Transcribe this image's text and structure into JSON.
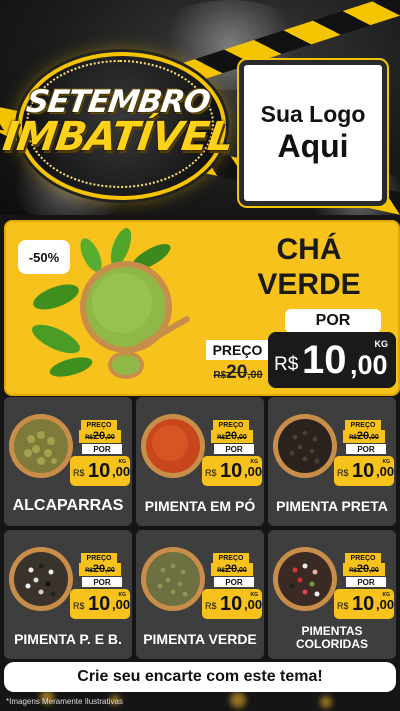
{
  "header": {
    "title_line1": "SETEMBRO",
    "title_line2": "IMBATÍVEL",
    "logo_line1": "Sua Logo",
    "logo_line2": "Aqui"
  },
  "hero": {
    "discount": "-50%",
    "name_line1": "CHÁ",
    "name_line2": "VERDE",
    "por_label": "POR",
    "preco_label": "PREÇO",
    "old_price": {
      "currency": "R$",
      "integer": "20",
      "decimal": ",00"
    },
    "new_price": {
      "currency": "R$",
      "integer": "10",
      "decimal": ",00",
      "unit": "KG"
    }
  },
  "products": [
    {
      "name": "ALCAPARRAS",
      "preco_label": "PREÇO",
      "por_label": "POR",
      "old_price": {
        "currency": "R$",
        "integer": "20",
        "decimal": ",00"
      },
      "new_price": {
        "currency": "R$",
        "integer": "10",
        "decimal": ",00",
        "unit": "KG"
      }
    },
    {
      "name": "PIMENTA EM PÓ",
      "preco_label": "PREÇO",
      "por_label": "POR",
      "old_price": {
        "currency": "R$",
        "integer": "20",
        "decimal": ",00"
      },
      "new_price": {
        "currency": "R$",
        "integer": "10",
        "decimal": ",00",
        "unit": "KG"
      }
    },
    {
      "name": "PIMENTA PRETA",
      "preco_label": "PREÇO",
      "por_label": "POR",
      "old_price": {
        "currency": "R$",
        "integer": "20",
        "decimal": ",00"
      },
      "new_price": {
        "currency": "R$",
        "integer": "10",
        "decimal": ",00",
        "unit": "KG"
      }
    },
    {
      "name": "PIMENTA P. E B.",
      "preco_label": "PREÇO",
      "por_label": "POR",
      "old_price": {
        "currency": "R$",
        "integer": "20",
        "decimal": ",00"
      },
      "new_price": {
        "currency": "R$",
        "integer": "10",
        "decimal": ",00",
        "unit": "KG"
      }
    },
    {
      "name": "PIMENTA VERDE",
      "preco_label": "PREÇO",
      "por_label": "POR",
      "old_price": {
        "currency": "R$",
        "integer": "20",
        "decimal": ",00"
      },
      "new_price": {
        "currency": "R$",
        "integer": "10",
        "decimal": ",00",
        "unit": "KG"
      }
    },
    {
      "name_line1": "PIMENTAS",
      "name_line2": "COLORIDAS",
      "preco_label": "PREÇO",
      "por_label": "POR",
      "old_price": {
        "currency": "R$",
        "integer": "20",
        "decimal": ",00"
      },
      "new_price": {
        "currency": "R$",
        "integer": "10",
        "decimal": ",00",
        "unit": "KG"
      }
    }
  ],
  "footer": {
    "cta": "Crie seu encarte com este tema!",
    "disclaimer": "*Imagens Meramente Ilustrativas"
  },
  "colors": {
    "accent_yellow": "#f6c21b",
    "card_gray": "#3e3e3e",
    "background": "#151515"
  },
  "icons": [
    "green-tea-powder-bowl",
    "capers-bowl",
    "chili-powder-bowl",
    "black-pepper-bowl",
    "mixed-pepper-bowl",
    "green-pepper-bowl",
    "colored-pepper-bowl"
  ]
}
